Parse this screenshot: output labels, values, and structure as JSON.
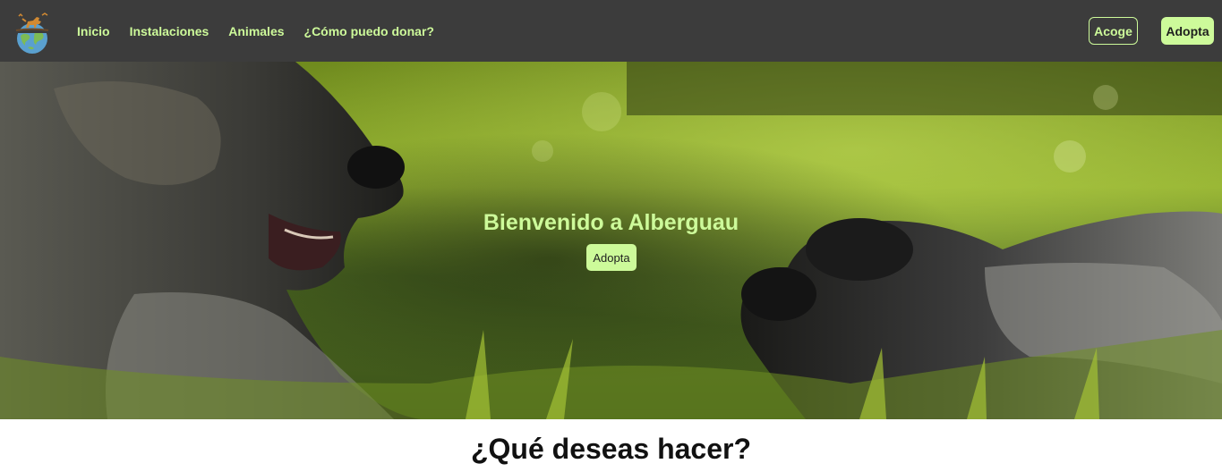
{
  "navbar": {
    "links": [
      "Inicio",
      "Instalaciones",
      "Animales",
      "¿Cómo puedo donar?"
    ],
    "acoge_label": "Acoge",
    "adopta_label": "Adopta"
  },
  "hero": {
    "title": "Bienvenido a Alberguau",
    "button_label": "Adopta"
  },
  "section": {
    "title": "¿Qué deseas hacer?"
  },
  "colors": {
    "navbar_bg": "#3c3c3c",
    "accent": "#cdfa9a",
    "text_dark": "#111111"
  }
}
